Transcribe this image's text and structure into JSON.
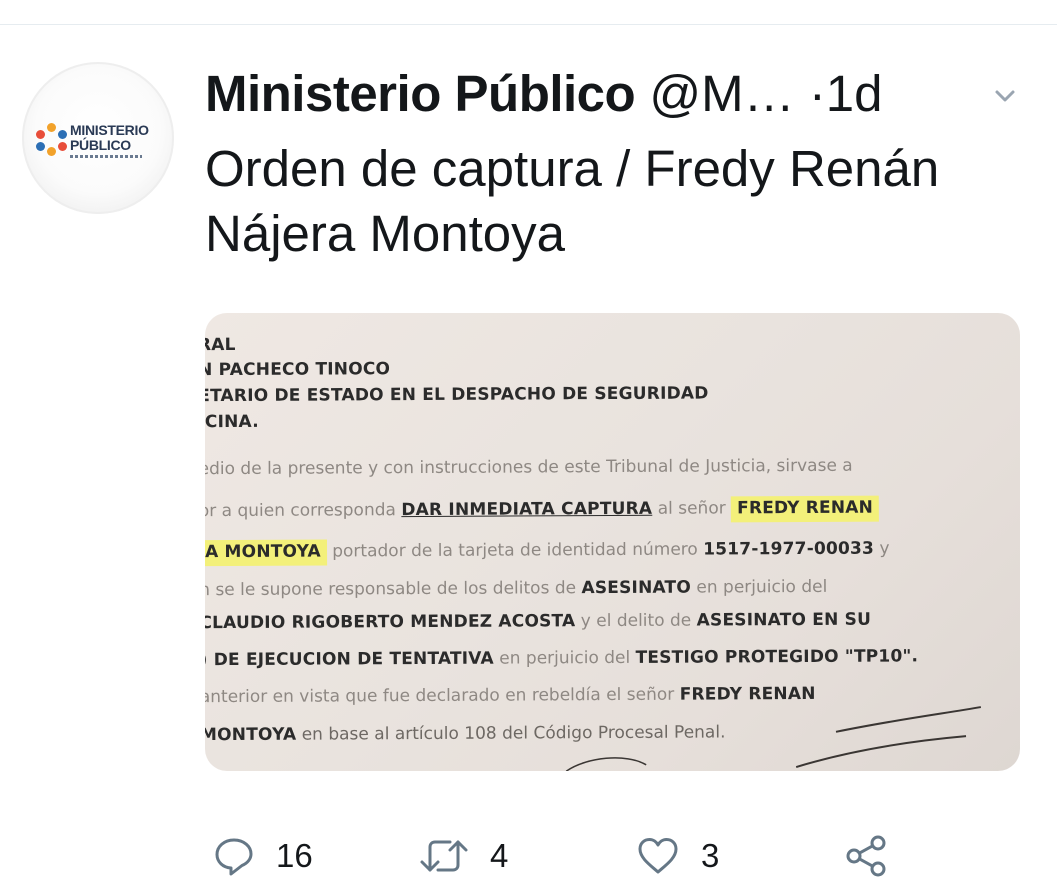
{
  "tweet": {
    "author_name": "Ministerio Público",
    "handle": "@M…",
    "separator": "·",
    "time": "1d",
    "text": "Orden de captura / Fredy Renán Nájera Montoya",
    "avatar": {
      "logo_line1": "MINISTERIO",
      "logo_line2": "PÚBLICO",
      "accent_colors": [
        "#f2a22b",
        "#2c6fb5",
        "#e84e3a"
      ]
    }
  },
  "media": {
    "lines": [
      "RAL",
      "N PACHECO TINOCO",
      "ETARIO DE ESTADO EN EL DESPACHO DE SEGURIDAD",
      "ICINA.",
      "edio de la presente y con instrucciones de este Tribunal de Justicia, sirvase a",
      {
        "a": "or a quien corresponda ",
        "b": "DAR INMEDIATA CAPTURA",
        "c": " al señor ",
        "d": "FREDY RENAN"
      },
      {
        "a": "A MONTOYA",
        "b": " portador de la tarjeta de identidad número ",
        "c": "1517-1977-00033",
        "d": " y"
      },
      {
        "a": "n se le supone responsable de los delitos de ",
        "b": "ASESINATO",
        "c": "  en perjuicio del"
      },
      {
        "a": "CLAUDIO RIGOBERTO MENDEZ ACOSTA",
        "b": " y el delito de ",
        "c": "ASESINATO EN SU"
      },
      {
        "a": ") DE EJECUCION DE TENTATIVA",
        "b": " en perjuicio del ",
        "c": "TESTIGO PROTEGIDO \"TP10\"."
      },
      {
        "a": " anterior en vista que fue declarado en  rebeldía el señor ",
        "b": "FREDY RENAN"
      },
      {
        "a": " MONTOYA",
        "b": " en base al artículo 108 del Código Procesal Penal."
      }
    ]
  },
  "actions": {
    "reply": {
      "icon": "reply-icon",
      "count": "16"
    },
    "retweet": {
      "icon": "retweet-icon",
      "count": "4"
    },
    "like": {
      "icon": "heart-icon",
      "count": "3"
    },
    "share": {
      "icon": "share-icon"
    }
  },
  "colors": {
    "text": "#14171a",
    "icon": "#657786",
    "divider": "#e6ecf0",
    "highlight": "#f3f07a"
  }
}
